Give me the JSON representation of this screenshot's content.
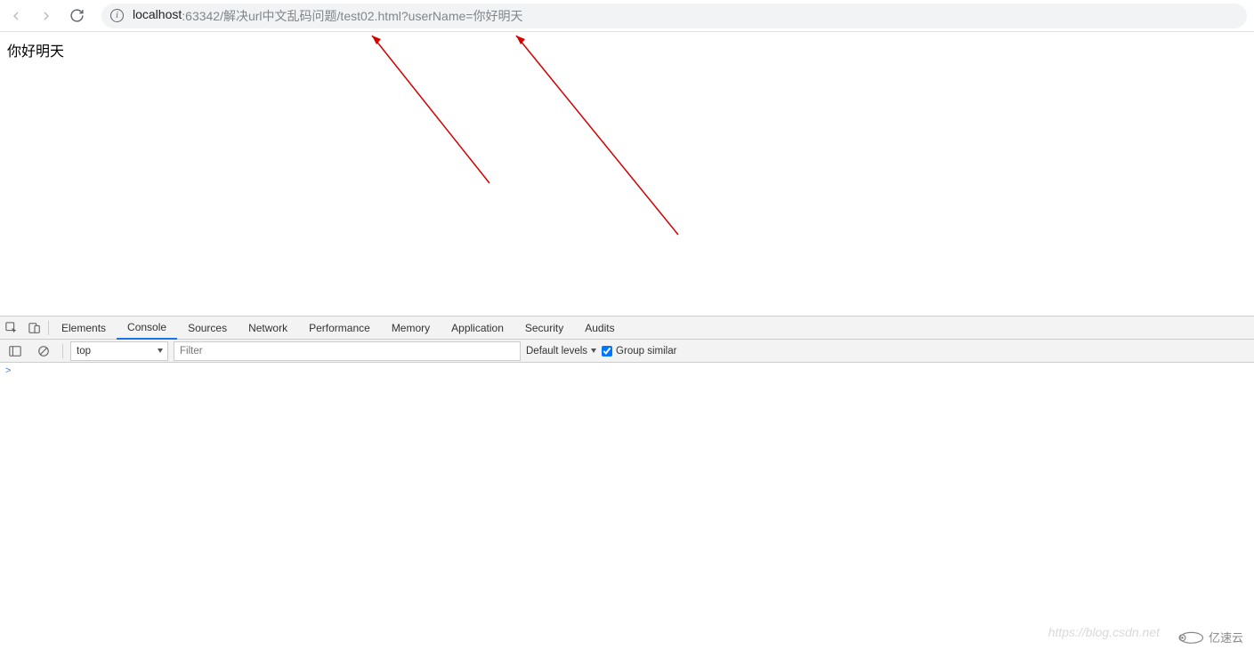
{
  "browser": {
    "url_host": "localhost",
    "url_rest": ":63342/解决url中文乱码问题/test02.html?userName=你好明天"
  },
  "page": {
    "body_text": "你好明天"
  },
  "devtools": {
    "tabs": [
      "Elements",
      "Console",
      "Sources",
      "Network",
      "Performance",
      "Memory",
      "Application",
      "Security",
      "Audits"
    ],
    "active_tab": "Console",
    "context": "top",
    "filter_placeholder": "Filter",
    "level_label": "Default levels",
    "group_similar_label": "Group similar",
    "group_similar_checked": true,
    "prompt": ">"
  },
  "watermark": {
    "text": "https://blog.csdn.net",
    "logo_text": "亿速云"
  }
}
